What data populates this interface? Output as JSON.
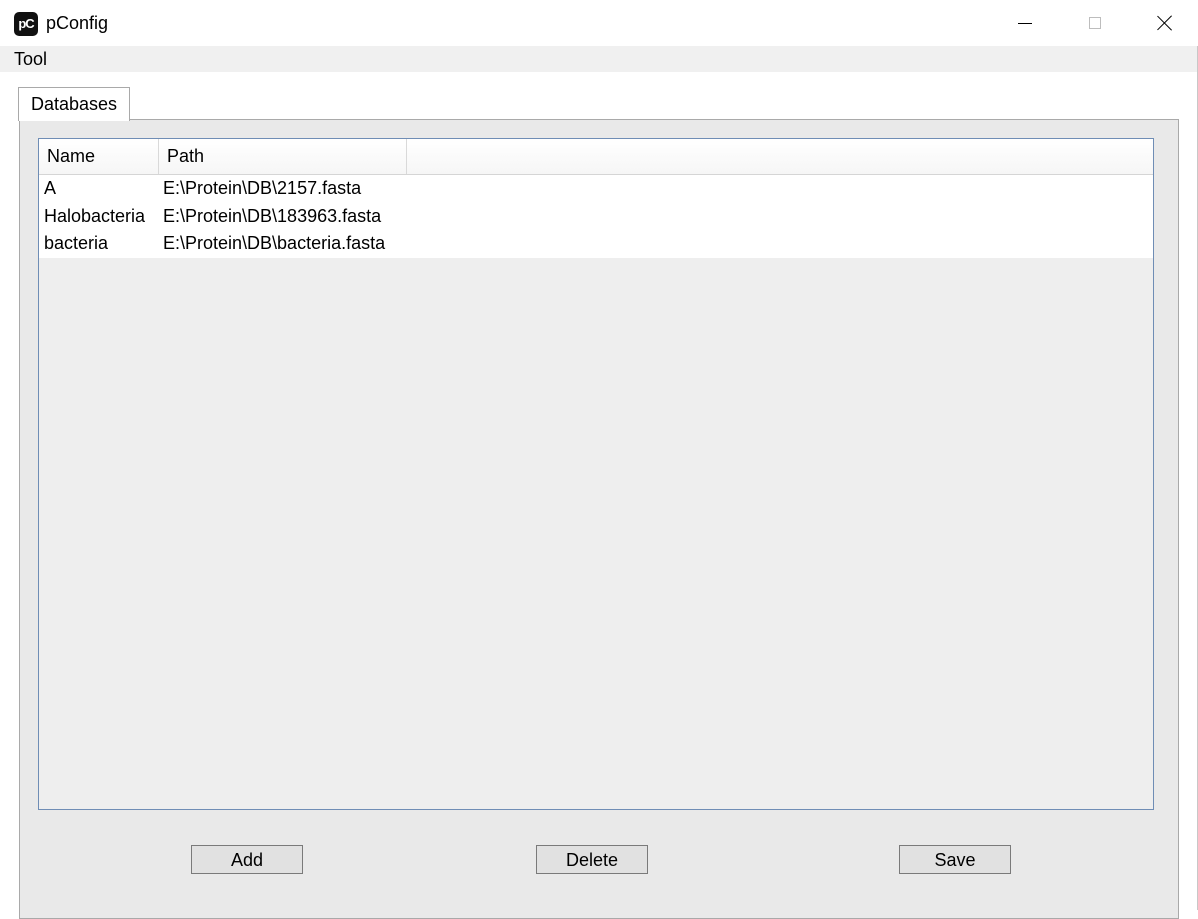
{
  "window": {
    "title": "pConfig",
    "icon_text": "pC"
  },
  "menu": {
    "items": [
      "Tool"
    ]
  },
  "tabs": [
    {
      "label": "Databases",
      "active": true
    }
  ],
  "table": {
    "columns": [
      "Name",
      "Path"
    ],
    "rows": [
      {
        "name": "A",
        "path": "E:\\Protein\\DB\\2157.fasta"
      },
      {
        "name": "Halobacteria",
        "path": "E:\\Protein\\DB\\183963.fasta"
      },
      {
        "name": "bacteria",
        "path": "E:\\Protein\\DB\\bacteria.fasta"
      }
    ]
  },
  "buttons": {
    "add": "Add",
    "delete": "Delete",
    "save": "Save"
  },
  "colors": {
    "table_border": "#6f8db5",
    "panel_bg": "#e9e9e9"
  }
}
